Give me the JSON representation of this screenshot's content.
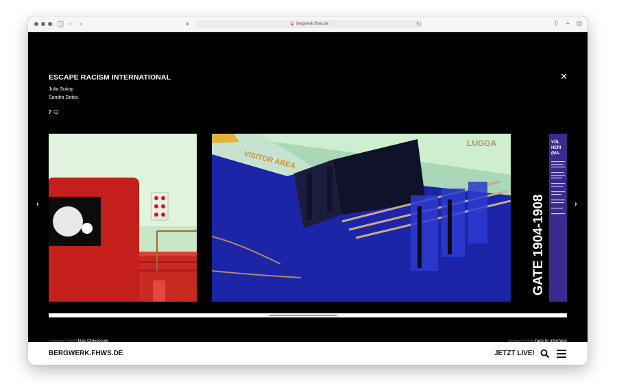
{
  "browser": {
    "url": "bergwerk.fhws.de"
  },
  "project": {
    "title": "ESCAPE RACISM INTERNATIONAL",
    "authors": [
      "Julia Sukop",
      "Sandra Dotou"
    ],
    "comment_count": "7"
  },
  "gallery": {
    "sign_top": "VISITOR AREA",
    "sign_right": "LUGGA",
    "vertical_title": "GATE 1904-1908",
    "panel_heading": "VÖL\nHERI\n(MA…",
    "scroll_position": 0.49
  },
  "nav": {
    "prev_caption": "Vorheriges Projekt",
    "prev_title": "Das Oniversum",
    "next_caption": "Nächstes Projekt",
    "next_title": "face to interface"
  },
  "footer": {
    "brand": "BERGWERK.FHWS.DE",
    "live_label": "JETZT LIVE!"
  },
  "icons": {
    "close": "close-icon",
    "prev": "chevron-left-icon",
    "next": "chevron-right-icon",
    "search": "search-icon",
    "menu": "hamburger-menu-icon",
    "comment": "speech-bubble-icon"
  },
  "colors": {
    "background": "#000000",
    "accent_blue": "#2e3aa8",
    "panel_purple": "#3b2a8e",
    "train_red": "#d42a22"
  }
}
